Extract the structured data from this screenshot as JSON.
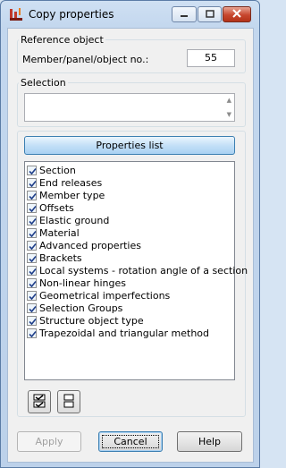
{
  "window": {
    "title": "Copy properties"
  },
  "reference": {
    "legend": "Reference object",
    "field_label": "Member/panel/object no.:",
    "field_value": "55"
  },
  "selection": {
    "legend": "Selection",
    "value": ""
  },
  "properties_button": "Properties list",
  "properties": [
    {
      "label": "Section",
      "checked": true
    },
    {
      "label": "End releases",
      "checked": true
    },
    {
      "label": "Member type",
      "checked": true
    },
    {
      "label": "Offsets",
      "checked": true
    },
    {
      "label": "Elastic ground",
      "checked": true
    },
    {
      "label": "Material",
      "checked": true
    },
    {
      "label": "Advanced properties",
      "checked": true
    },
    {
      "label": "Brackets",
      "checked": true
    },
    {
      "label": "Local systems - rotation angle of a section",
      "checked": true
    },
    {
      "label": "Non-linear hinges",
      "checked": true
    },
    {
      "label": "Geometrical imperfections",
      "checked": true
    },
    {
      "label": "Selection Groups",
      "checked": true
    },
    {
      "label": "Structure object type",
      "checked": true
    },
    {
      "label": "Trapezoidal and triangular method",
      "checked": true
    }
  ],
  "icons": {
    "app": "copy-properties-icon",
    "select_all": "check-all-icon",
    "deselect_all": "uncheck-all-icon"
  },
  "buttons": {
    "apply": "Apply",
    "cancel": "Cancel",
    "help": "Help"
  }
}
